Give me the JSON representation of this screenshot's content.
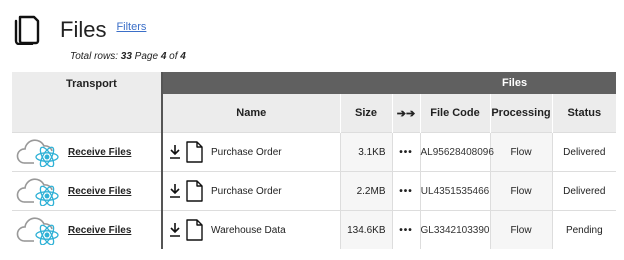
{
  "header": {
    "title": "Files",
    "filters_link": "Filters"
  },
  "meta": {
    "total_label": "Total rows:",
    "total": "33",
    "page_label": "Page",
    "page": "4",
    "of_label": "of",
    "page_count": "4"
  },
  "table": {
    "group_transport": "Transport",
    "group_files": "Files",
    "columns": {
      "name": "Name",
      "size": "Size",
      "arrows": "➔➔",
      "code": "File Code",
      "processing": "Processing",
      "status": "Status"
    },
    "rows": [
      {
        "transport": "Receive Files",
        "name": "Purchase Order",
        "size": "3.1KB",
        "dots": "•••",
        "code": "AL95628408096",
        "processing": "Flow",
        "status": "Delivered"
      },
      {
        "transport": "Receive Files",
        "name": "Purchase Order",
        "size": "2.2MB",
        "dots": "•••",
        "code": "UL4351535466",
        "processing": "Flow",
        "status": "Delivered"
      },
      {
        "transport": "Receive Files",
        "name": "Warehouse Data",
        "size": "134.6KB",
        "dots": "•••",
        "code": "GL3342103390",
        "processing": "Flow",
        "status": "Pending"
      }
    ]
  },
  "icons": {
    "files": "files-icon",
    "cloud_react": "cloud-react-icon",
    "download": "download-icon",
    "document": "document-icon"
  }
}
